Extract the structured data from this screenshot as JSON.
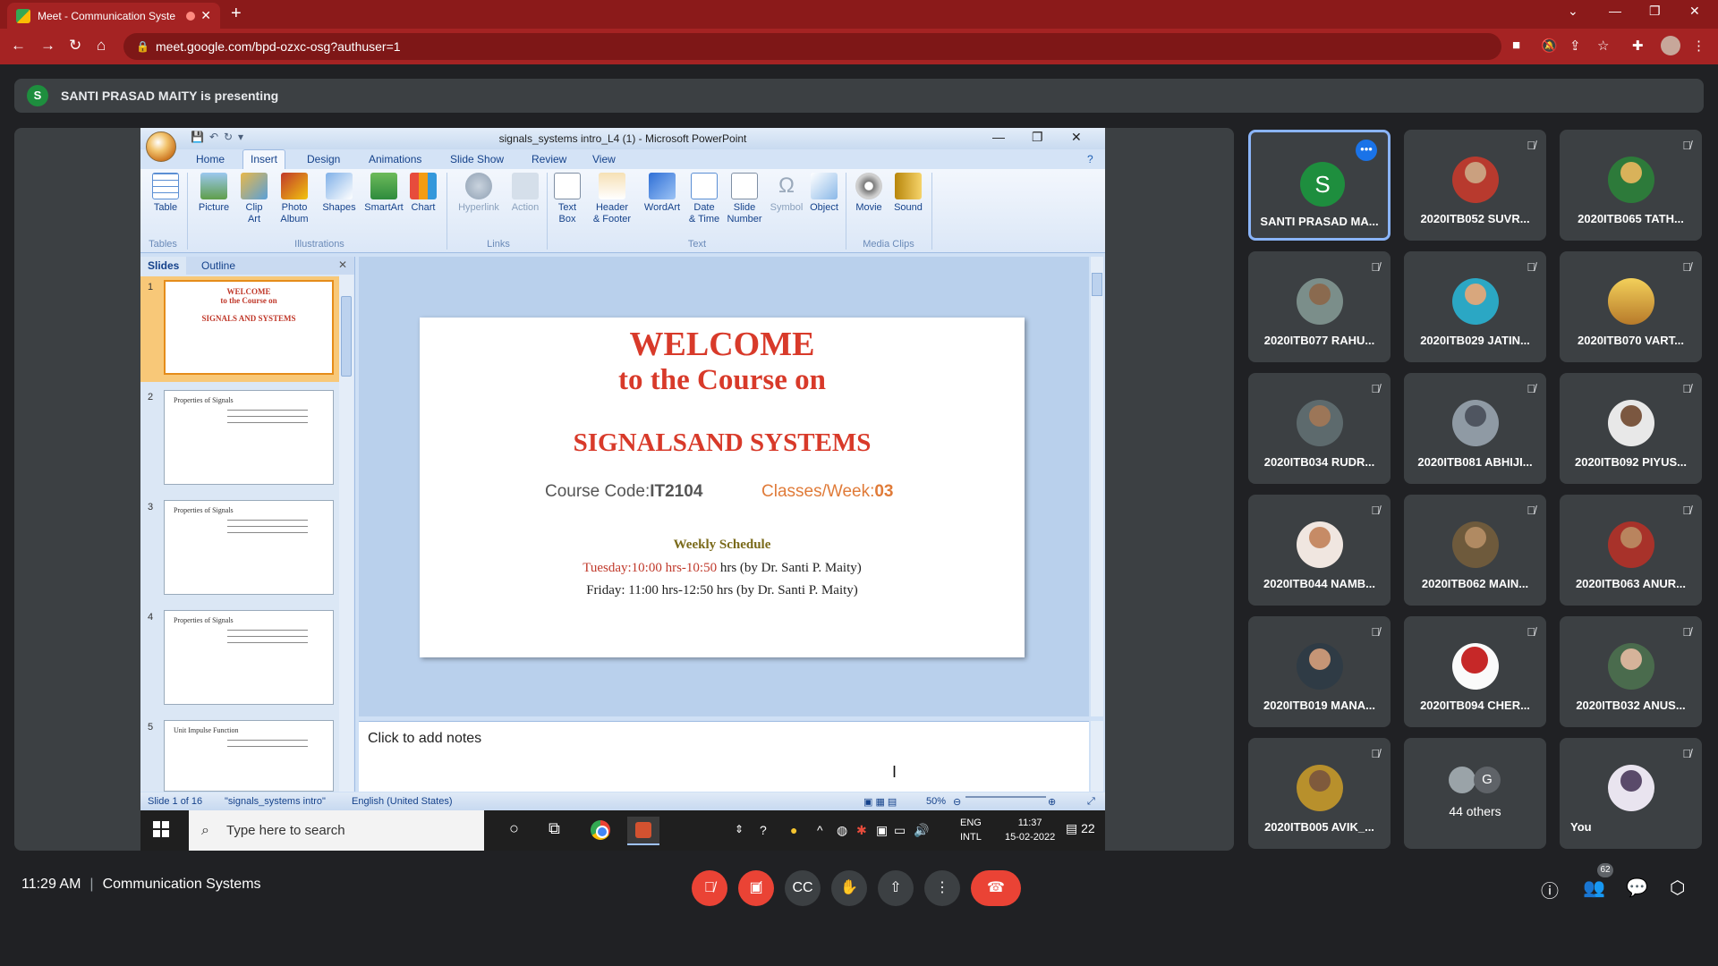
{
  "browser": {
    "tab_title": "Meet - Communication Syste",
    "url": "meet.google.com/bpd-ozxc-osg?authuser=1"
  },
  "banner": {
    "avatar_letter": "S",
    "text": "SANTI PRASAD MAITY is presenting"
  },
  "powerpoint": {
    "window_title": "signals_systems intro_L4 (1) - Microsoft PowerPoint",
    "tabs": [
      "Home",
      "Insert",
      "Design",
      "Animations",
      "Slide Show",
      "Review",
      "View"
    ],
    "active_tab": "Insert",
    "ribbon": {
      "table": "Table",
      "picture": "Picture",
      "clip_art_1": "Clip",
      "clip_art_2": "Art",
      "photo_album_1": "Photo",
      "photo_album_2": "Album",
      "shapes": "Shapes",
      "smartart": "SmartArt",
      "chart": "Chart",
      "hyperlink": "Hyperlink",
      "action": "Action",
      "text_box_1": "Text",
      "text_box_2": "Box",
      "header_footer_1": "Header",
      "header_footer_2": "& Footer",
      "wordart": "WordArt",
      "date_time_1": "Date",
      "date_time_2": "& Time",
      "slide_number_1": "Slide",
      "slide_number_2": "Number",
      "symbol": "Symbol",
      "object": "Object",
      "movie": "Movie",
      "sound": "Sound",
      "groups": {
        "tables": "Tables",
        "illustrations": "Illustrations",
        "links": "Links",
        "text": "Text",
        "media_clips": "Media Clips"
      }
    },
    "pane_tabs": {
      "slides": "Slides",
      "outline": "Outline"
    },
    "thumbnails": [
      {
        "num": "1",
        "line1": "WELCOME",
        "line2": "to the Course on",
        "line3": "SIGNALS AND SYSTEMS"
      },
      {
        "num": "2",
        "title": "Properties of Signals"
      },
      {
        "num": "3",
        "title": "Properties of Signals"
      },
      {
        "num": "4",
        "title": "Properties of Signals"
      },
      {
        "num": "5",
        "title": "Unit Impulse Function"
      }
    ],
    "slide": {
      "welcome": "WELCOME",
      "course_on": "to the Course on",
      "subject": "SIGNALSAND SYSTEMS",
      "code_label": "Course Code:",
      "code_value": "IT2104",
      "classes_label": "Classes/Week:",
      "classes_value": "03",
      "schedule_title": "Weekly Schedule",
      "tuesday_time": "Tuesday:10:00 hrs-10:50",
      "tuesday_rest": " hrs (by Dr. Santi P. Maity)",
      "friday": "Friday: 11:00 hrs-12:50 hrs (by Dr. Santi P. Maity)"
    },
    "notes_placeholder": "Click to add notes",
    "status": {
      "slide_of": "Slide 1 of 16",
      "theme": "\"signals_systems intro\"",
      "language": "English (United States)",
      "zoom": "50%"
    }
  },
  "taskbar": {
    "search_placeholder": "Type here to search",
    "lang_1": "ENG",
    "lang_2": "INTL",
    "time": "11:37",
    "date": "15-02-2022",
    "notif_count": "22"
  },
  "participants": [
    {
      "name": "SANTI PRASAD MA...",
      "avatar_letter": "S"
    },
    {
      "name": "2020ITB052 SUVR..."
    },
    {
      "name": "2020ITB065 TATH..."
    },
    {
      "name": "2020ITB077 RAHU..."
    },
    {
      "name": "2020ITB029 JATIN..."
    },
    {
      "name": "2020ITB070 VART..."
    },
    {
      "name": "2020ITB034 RUDR..."
    },
    {
      "name": "2020ITB081 ABHIJI..."
    },
    {
      "name": "2020ITB092 PIYUS..."
    },
    {
      "name": "2020ITB044 NAMB..."
    },
    {
      "name": "2020ITB062 MAIN..."
    },
    {
      "name": "2020ITB063 ANUR..."
    },
    {
      "name": "2020ITB019 MANA..."
    },
    {
      "name": "2020ITB094 CHER..."
    },
    {
      "name": "2020ITB032 ANUS..."
    },
    {
      "name": "2020ITB005 AVIK_..."
    }
  ],
  "others_tile": {
    "label": "44 others",
    "letter": "G"
  },
  "you_tile": {
    "label": "You"
  },
  "meeting": {
    "time": "11:29 AM",
    "title": "Communication Systems",
    "people_count": "62"
  },
  "colors": {
    "tab_bar": "#8b1a1a",
    "presenter_green": "#1e8e3e",
    "danger_red": "#ea4335",
    "slide_title_red": "#d83a2a"
  }
}
